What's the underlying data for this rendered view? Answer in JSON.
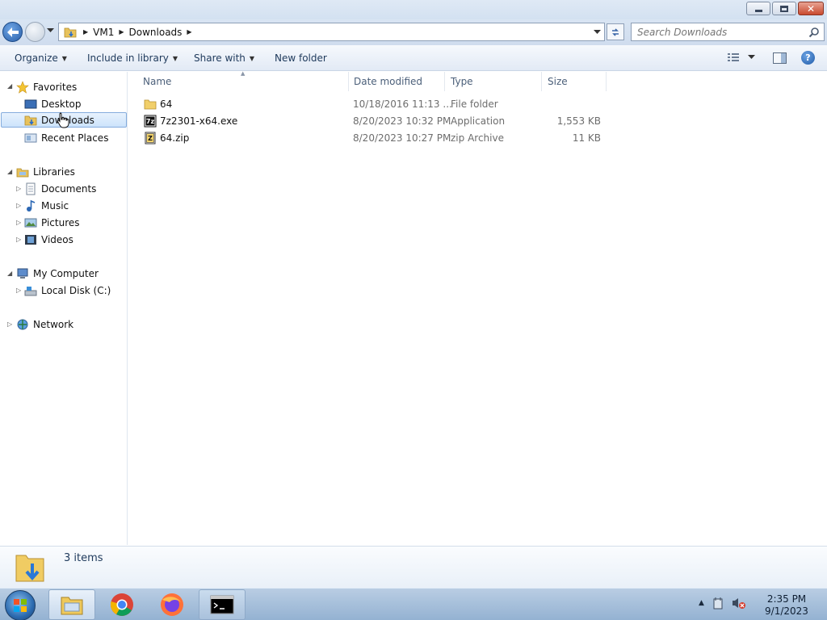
{
  "window": {
    "controls": {
      "minimize": "minimize",
      "maximize": "maximize",
      "close": "close"
    }
  },
  "address": {
    "breadcrumb": [
      "VM1",
      "Downloads"
    ],
    "search_placeholder": "Search Downloads"
  },
  "toolbar": {
    "organize": "Organize",
    "include_in_library": "Include in library",
    "share_with": "Share with",
    "new_folder": "New folder"
  },
  "nav": {
    "favorites": "Favorites",
    "desktop": "Desktop",
    "downloads": "Downloads",
    "recent_places": "Recent Places",
    "libraries": "Libraries",
    "documents": "Documents",
    "music": "Music",
    "pictures": "Pictures",
    "videos": "Videos",
    "my_computer": "My Computer",
    "local_disk": "Local Disk (C:)",
    "network": "Network"
  },
  "columns": {
    "name": "Name",
    "date_modified": "Date modified",
    "type": "Type",
    "size": "Size"
  },
  "files": [
    {
      "name": "64",
      "date": "10/18/2016 11:13 ...",
      "type": "File folder",
      "size": "",
      "icon": "folder-icon"
    },
    {
      "name": "7z2301-x64.exe",
      "date": "8/20/2023 10:32 PM",
      "type": "Application",
      "size": "1,553 KB",
      "icon": "7zip-exe-icon"
    },
    {
      "name": "64.zip",
      "date": "8/20/2023 10:27 PM",
      "type": "zip Archive",
      "size": "11 KB",
      "icon": "zip-archive-icon"
    }
  ],
  "details": {
    "item_count": "3 items"
  },
  "taskbar": {
    "time": "2:35 PM",
    "date": "9/1/2023"
  },
  "colors": {
    "selection": "#cce3fb",
    "accent": "#1e395b",
    "taskbar": "#a8c2df"
  }
}
